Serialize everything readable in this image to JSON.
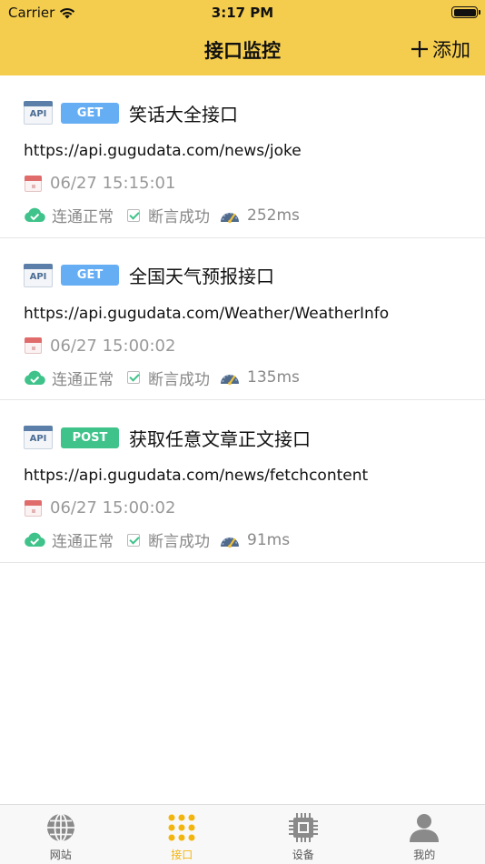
{
  "status_bar": {
    "carrier": "Carrier",
    "time": "3:17 PM"
  },
  "nav": {
    "title": "接口监控",
    "add_label": "添加"
  },
  "items": [
    {
      "api_badge": "API",
      "method": "GET",
      "title": "笑话大全接口",
      "url": "https://api.gugudata.com/news/joke",
      "datetime": "06/27 15:15:01",
      "connectivity": "连通正常",
      "assertion": "断言成功",
      "latency": "252ms"
    },
    {
      "api_badge": "API",
      "method": "GET",
      "title": "全国天气预报接口",
      "url": "https://api.gugudata.com/Weather/WeatherInfo",
      "datetime": "06/27 15:00:02",
      "connectivity": "连通正常",
      "assertion": "断言成功",
      "latency": "135ms"
    },
    {
      "api_badge": "API",
      "method": "POST",
      "title": "获取任意文章正文接口",
      "url": "https://api.gugudata.com/news/fetchcontent",
      "datetime": "06/27 15:00:02",
      "connectivity": "连通正常",
      "assertion": "断言成功",
      "latency": "91ms"
    }
  ],
  "tabbar": {
    "tabs": [
      {
        "label": "网站",
        "icon": "globe-icon",
        "active": false
      },
      {
        "label": "接口",
        "icon": "grid-dots-icon",
        "active": true
      },
      {
        "label": "设备",
        "icon": "cpu-chip-icon",
        "active": false
      },
      {
        "label": "我的",
        "icon": "person-icon",
        "active": false
      }
    ]
  },
  "colors": {
    "header_bg": "#f5cd4e",
    "get_badge": "#66aef4",
    "post_badge": "#3fc38a",
    "active_tab": "#f2b50f",
    "ok_green": "#3fc38a"
  }
}
